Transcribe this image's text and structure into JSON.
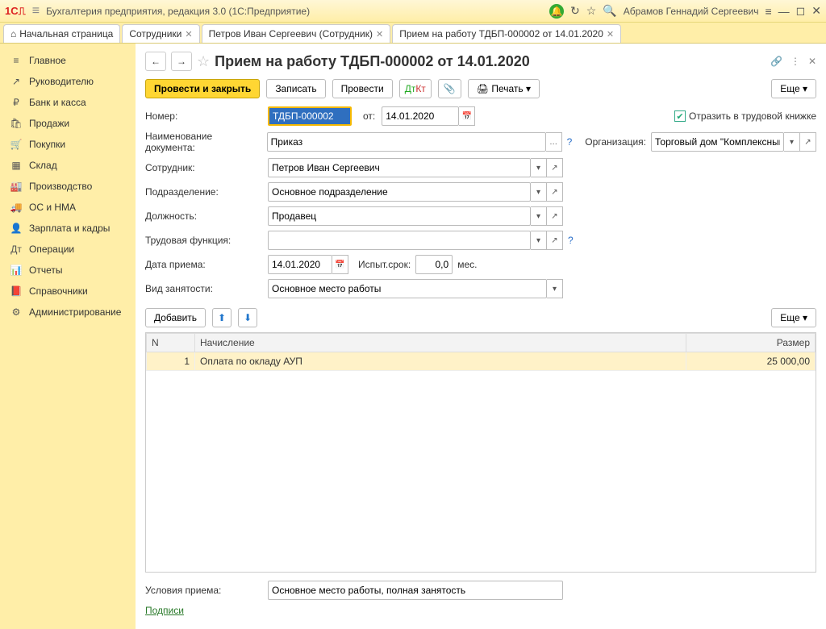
{
  "app": {
    "title": "Бухгалтерия предприятия, редакция 3.0  (1С:Предприятие)",
    "user": "Абрамов Геннадий Сергеевич"
  },
  "tabs": {
    "home": "Начальная страница",
    "t1": "Сотрудники",
    "t2": "Петров Иван Сергеевич (Сотрудник)",
    "t3": "Прием на работу ТДБП-000002 от 14.01.2020"
  },
  "sidebar": [
    {
      "icon": "≡",
      "label": "Главное"
    },
    {
      "icon": "↗",
      "label": "Руководителю"
    },
    {
      "icon": "₽",
      "label": "Банк и касса"
    },
    {
      "icon": "🛍",
      "label": "Продажи"
    },
    {
      "icon": "🛒",
      "label": "Покупки"
    },
    {
      "icon": "▦",
      "label": "Склад"
    },
    {
      "icon": "🏭",
      "label": "Производство"
    },
    {
      "icon": "🚚",
      "label": "ОС и НМА"
    },
    {
      "icon": "👤",
      "label": "Зарплата и кадры"
    },
    {
      "icon": "Дт",
      "label": "Операции"
    },
    {
      "icon": "📊",
      "label": "Отчеты"
    },
    {
      "icon": "📕",
      "label": "Справочники"
    },
    {
      "icon": "⚙",
      "label": "Администрирование"
    }
  ],
  "doc": {
    "title": "Прием на работу ТДБП-000002 от 14.01.2020",
    "buttons": {
      "post_close": "Провести и закрыть",
      "write": "Записать",
      "post": "Провести",
      "print": "Печать",
      "more": "Еще"
    },
    "labels": {
      "number": "Номер:",
      "from": "от:",
      "doc_name": "Наименование документа:",
      "employee": "Сотрудник:",
      "department": "Подразделение:",
      "position": "Должность:",
      "labor_func": "Трудовая функция:",
      "hire_date": "Дата приема:",
      "probation": "Испыт.срок:",
      "months": "мес.",
      "employment": "Вид занятости:",
      "reflect": "Отразить в трудовой книжке",
      "org": "Организация:",
      "add": "Добавить",
      "conditions": "Условия приема:",
      "signatures": "Подписи"
    },
    "values": {
      "number": "ТДБП-000002",
      "date": "14.01.2020",
      "doc_name": "Приказ",
      "employee": "Петров Иван Сергеевич",
      "department": "Основное подразделение",
      "position": "Продавец",
      "labor_func": "",
      "hire_date": "14.01.2020",
      "probation": "0,0",
      "employment": "Основное место работы",
      "org": "Торговый дом \"Комплексный\"",
      "conditions": "Основное место работы, полная занятость",
      "reflect_checked": true
    },
    "table": {
      "headers": {
        "n": "N",
        "accrual": "Начисление",
        "amount": "Размер"
      },
      "rows": [
        {
          "n": "1",
          "accrual": "Оплата по окладу АУП",
          "amount": "25 000,00"
        }
      ]
    }
  }
}
